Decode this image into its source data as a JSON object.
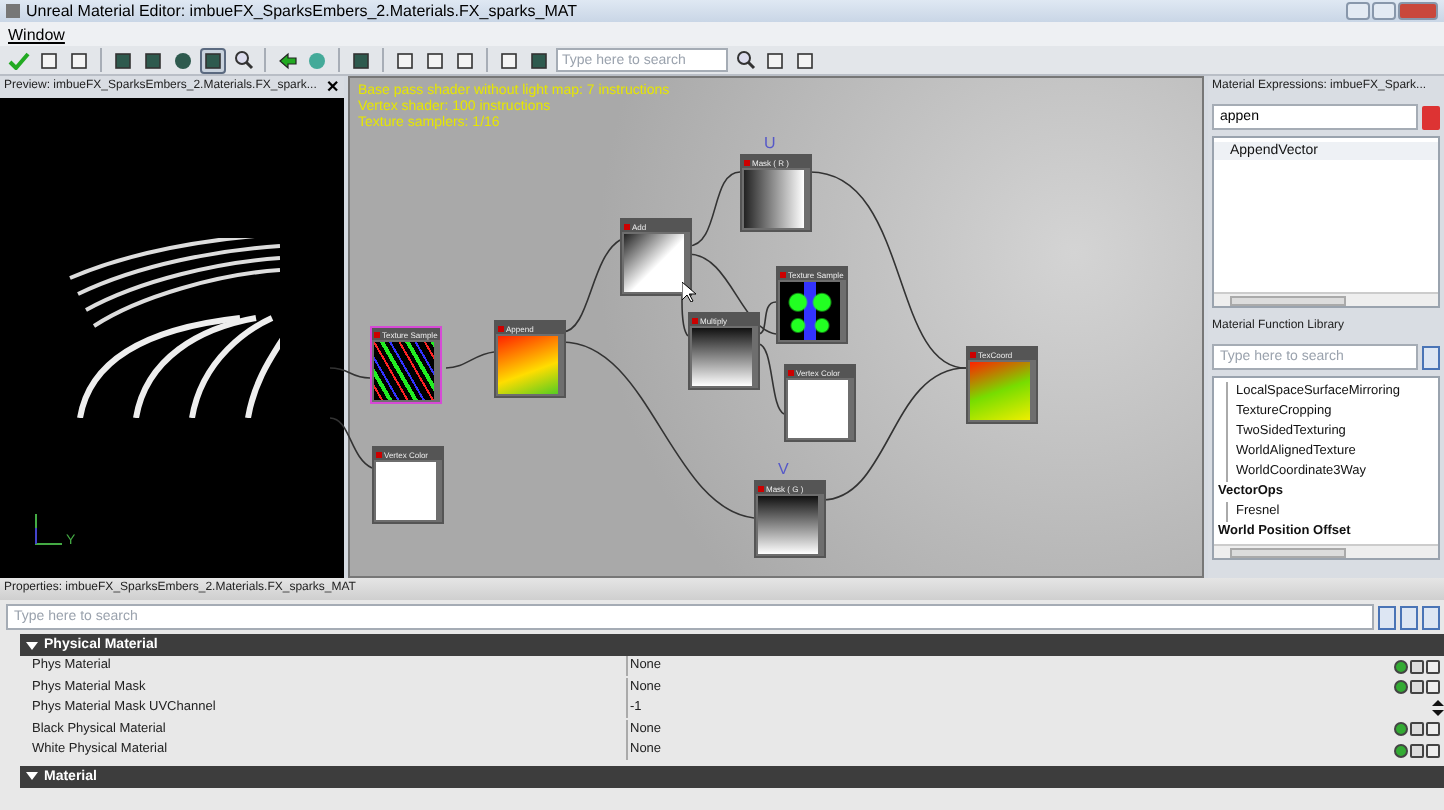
{
  "window": {
    "title": "Unreal Material Editor: imbueFX_SparksEmbers_2.Materials.FX_sparks_MAT"
  },
  "menu": [
    "Window"
  ],
  "toolbar": {
    "search": {
      "placeholder": "Type here to search"
    }
  },
  "preview": {
    "title": "Preview: imbueFX_SparksEmbers_2.Materials.FX_spark...",
    "close": "✕",
    "axis_label": "Y"
  },
  "graph": {
    "stats": [
      "Base pass shader without light map: 7 instructions",
      "Vertex shader: 100 instructions",
      "Texture samplers: 1/16"
    ],
    "nodes": [
      {
        "title": "Texture Sample",
        "kind": "texture",
        "selected": true
      },
      {
        "title": "Vertex Color",
        "kind": "white",
        "selected": false
      },
      {
        "title": "Append",
        "kind": "orange",
        "selected": false
      },
      {
        "title": "Add",
        "kind": "diagonal",
        "selected": false
      },
      {
        "title": "Mask ( R )",
        "kind": "horizontal",
        "selected": false,
        "caption": "U"
      },
      {
        "title": "Texture Sample",
        "kind": "dots",
        "selected": false
      },
      {
        "title": "Multiply",
        "kind": "vertical",
        "selected": false
      },
      {
        "title": "Vertex Color",
        "kind": "white",
        "selected": false
      },
      {
        "title": "TexCoord",
        "kind": "uv",
        "selected": false
      },
      {
        "title": "Mask ( G )",
        "kind": "vertical",
        "selected": false,
        "caption": "V"
      }
    ]
  },
  "expressions": {
    "title": "Material Expressions: imbueFX_Spark...",
    "search": {
      "value": "appen"
    },
    "items": [
      {
        "label": "AppendVector",
        "selected": false
      }
    ]
  },
  "function_library": {
    "title": "Material Function Library",
    "search": {
      "placeholder": "Type here to search"
    },
    "tree": [
      {
        "label": "LocalSpaceSurfaceMirroring",
        "kind": "function"
      },
      {
        "label": "TextureCropping",
        "kind": "function"
      },
      {
        "label": "TwoSidedTexturing",
        "kind": "function"
      },
      {
        "label": "WorldAlignedTexture",
        "kind": "function"
      },
      {
        "label": "WorldCoordinate3Way",
        "kind": "function"
      },
      {
        "label": "VectorOps",
        "kind": "category",
        "children": [
          {
            "label": "Fresnel"
          }
        ]
      },
      {
        "label": "World Position Offset",
        "kind": "category"
      }
    ]
  },
  "properties": {
    "title": "Properties: imbueFX_SparksEmbers_2.Materials.FX_sparks_MAT",
    "search": {
      "placeholder": "Type here to search"
    },
    "sections": [
      {
        "title": "Physical Material",
        "expanded": true,
        "rows": [
          {
            "name": "Phys Material",
            "value": "None",
            "kind": "object"
          },
          {
            "name": "Phys Material Mask",
            "value": "None",
            "kind": "object"
          },
          {
            "name": "Phys Material Mask UVChannel",
            "value": "-1",
            "kind": "number"
          },
          {
            "name": "Black Physical Material",
            "value": "None",
            "kind": "object"
          },
          {
            "name": "White Physical Material",
            "value": "None",
            "kind": "object"
          }
        ]
      },
      {
        "title": "Material",
        "expanded": true
      }
    ]
  }
}
